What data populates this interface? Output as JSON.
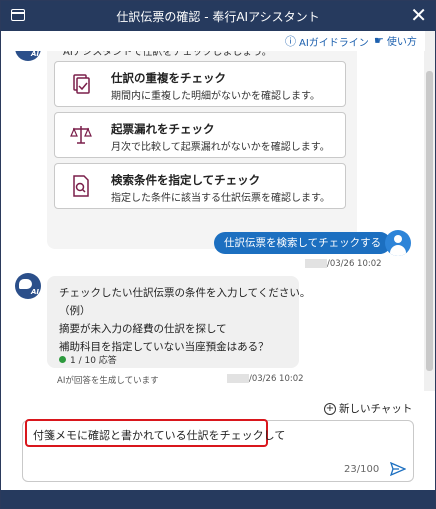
{
  "window": {
    "title": "仕訳伝票の確認 - 奉行AIアシスタント",
    "close_label": "✕"
  },
  "links": {
    "guideline": "AIガイドライン",
    "howto": "使い方"
  },
  "ai_intro": {
    "text": "AIアシスタントで仕訳をチェックしましょう。"
  },
  "cards": [
    {
      "title": "仕訳の重複をチェック",
      "desc": "期間内に重複した明細がないかを確認します。",
      "icon": "duplicate-check-icon"
    },
    {
      "title": "起票漏れをチェック",
      "desc": "月次で比較して起票漏れがないかを確認します。",
      "icon": "balance-scale-icon"
    },
    {
      "title": "検索条件を指定してチェック",
      "desc": "指定した条件に該当する仕訳伝票を確認します。",
      "icon": "search-document-icon"
    }
  ],
  "user_message": {
    "text": "仕訳伝票を検索してチェックする",
    "timestamp": "/03/26 10:02"
  },
  "ai_message": {
    "lines": [
      "チェックしたい仕訳伝票の条件を入力してください。",
      "（例）",
      "摘要が未入力の経費の仕訳を探して",
      "補助科目を指定していない当座預金はある？"
    ],
    "count": "1 / 10 応答",
    "note": "AIが回答を生成しています",
    "timestamp": "/03/26 10:02"
  },
  "new_chat": {
    "label": "新しいチャット"
  },
  "input": {
    "value": "付箋メモに確認と書かれている仕訳をチェックして",
    "counter": "23/100"
  },
  "colors": {
    "titlebar": "#263a5e",
    "accent": "#1c6fc0",
    "highlight": "#d9161c"
  }
}
